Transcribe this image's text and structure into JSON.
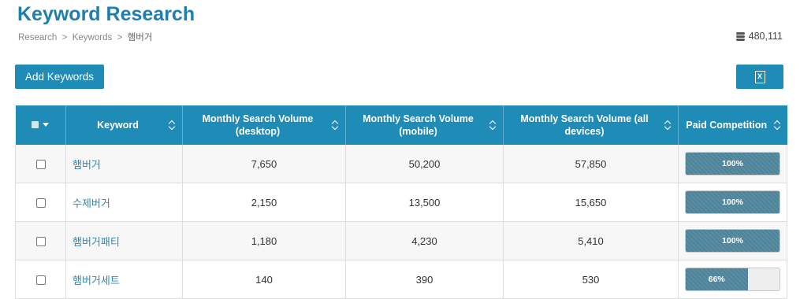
{
  "header": {
    "title": "Keyword Research",
    "breadcrumb": [
      "Research",
      "Keywords",
      "햄버거"
    ],
    "credits": "480,111"
  },
  "toolbar": {
    "add_label": "Add Keywords",
    "export_icon": "excel-file-icon",
    "export_icon_text": "X"
  },
  "table": {
    "columns": [
      "Keyword",
      "Monthly Search Volume (desktop)",
      "Monthly Search Volume (mobile)",
      "Monthly Search Volume (all devices)",
      "Paid Competition"
    ],
    "rows": [
      {
        "keyword": "햄버거",
        "desktop": "7,650",
        "mobile": "50,200",
        "all": "57,850",
        "competition": "100%",
        "competition_value": 1.0
      },
      {
        "keyword": "수제버거",
        "desktop": "2,150",
        "mobile": "13,500",
        "all": "15,650",
        "competition": "100%",
        "competition_value": 1.0
      },
      {
        "keyword": "햄버거패티",
        "desktop": "1,180",
        "mobile": "4,230",
        "all": "5,410",
        "competition": "100%",
        "competition_value": 1.0
      },
      {
        "keyword": "햄버거세트",
        "desktop": "140",
        "mobile": "390",
        "all": "530",
        "competition": "66%",
        "competition_value": 0.66
      }
    ]
  },
  "colors": {
    "accent": "#1f8bb7",
    "title": "#1e7fae",
    "link": "#2a88bd",
    "bar_fill": "#5a8da3"
  }
}
